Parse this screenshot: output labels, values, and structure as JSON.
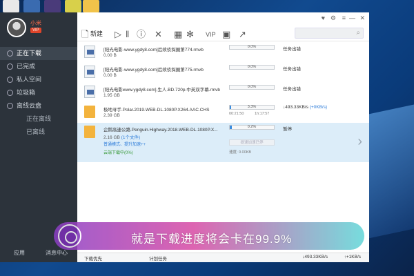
{
  "sidebar": {
    "username": "小米",
    "vip_badge": "VIP",
    "items": [
      {
        "label": "正在下载",
        "active": true
      },
      {
        "label": "已完成"
      },
      {
        "label": "私人空间"
      },
      {
        "label": "垃圾箱"
      },
      {
        "label": "离线云盘",
        "sub": false
      },
      {
        "label": "正在离线",
        "sub": true
      },
      {
        "label": "已离线",
        "sub": true
      }
    ],
    "footer_left": "应用",
    "footer_right": "消息中心"
  },
  "toolbar": {
    "new_label": "新建"
  },
  "downloads": [
    {
      "name": "[阳光电影-www.ygdy8.com]后续侦探圈第774.rmvb",
      "size": "0.00 B",
      "progress": 0.0,
      "pct": "0.0%",
      "status": "任务出错",
      "type": "video"
    },
    {
      "name": "[阳光电影-www.ygdy8.com]后续侦探圈第775.rmvb",
      "size": "0.00 B",
      "progress": 0.0,
      "pct": "0.0%",
      "status": "任务出错",
      "type": "video"
    },
    {
      "name": "[阳光电影www.ygdy8.com].生人.BD.720p.中英双字幕.rmvb",
      "size": "1.95 GB",
      "progress": 0.0,
      "pct": "0.0%",
      "status": "任务出错",
      "type": "video"
    },
    {
      "name": "极地寻手.Polar.2019.WEB-DL.1080P.X264.AAC.CHS",
      "size": "2.39 GB",
      "progress": 0.033,
      "pct": "3.3%",
      "times": "00:21:50",
      "times2": "1h:17:57",
      "speed": "493.33KB/s",
      "speed2": "(+0KB/s)",
      "type": "folder"
    },
    {
      "name": "企鹅高速公路.Penguin.Highway.2018.WEB-DL.1080P.X...",
      "size": "2.16 GB",
      "files": "(1个文件)",
      "progress": 0.002,
      "pct": "0.2%",
      "status": "暂停",
      "type": "folder",
      "line1": "普通模式、提升加速++",
      "line2": "云端下载中(0%)",
      "accel": "提速加速已停",
      "speed_small": "速度: 0.00KB"
    }
  ],
  "statusbar": {
    "left1": "下载优先",
    "left2": "计划任务",
    "down_speed": "493.33KB/s",
    "up_speed": "+1KB/s"
  },
  "caption": {
    "text": "就是下载进度将会卡在99.9%"
  }
}
